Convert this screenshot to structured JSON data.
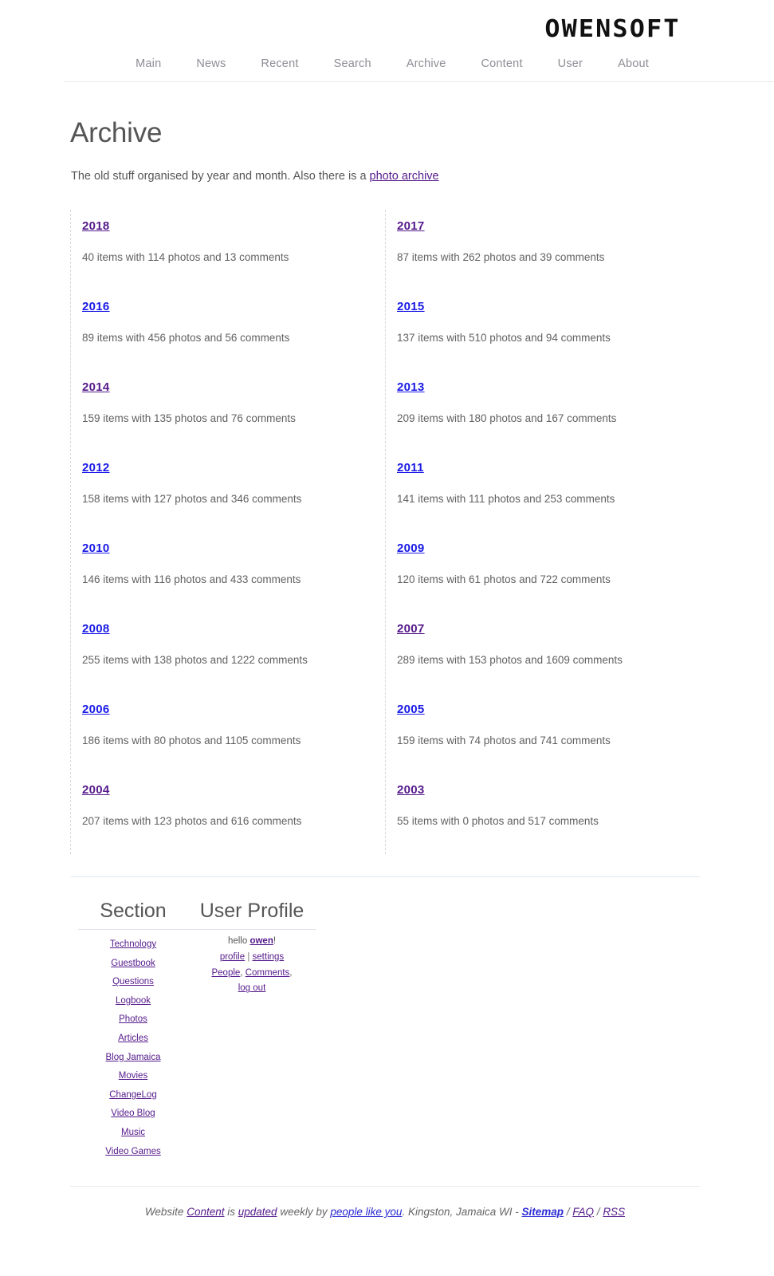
{
  "site": {
    "logo": "OWENSOFT"
  },
  "nav": {
    "items": [
      {
        "label": "Main"
      },
      {
        "label": "News"
      },
      {
        "label": "Recent"
      },
      {
        "label": "Search"
      },
      {
        "label": "Archive"
      },
      {
        "label": "Content"
      },
      {
        "label": "User"
      },
      {
        "label": "About"
      }
    ]
  },
  "page": {
    "title": "Archive",
    "intro_before": "The old stuff organised by year and month. Also there is a ",
    "intro_link": "photo archive"
  },
  "archive": {
    "left": [
      {
        "year": "2018",
        "state": "visited",
        "stats": "40 items with 114 photos and 13 comments"
      },
      {
        "year": "2016",
        "state": "unvisited",
        "stats": "89 items with 456 photos and 56 comments"
      },
      {
        "year": "2014",
        "state": "visited",
        "stats": "159 items with 135 photos and 76 comments"
      },
      {
        "year": "2012",
        "state": "unvisited",
        "stats": "158 items with 127 photos and 346 comments"
      },
      {
        "year": "2010",
        "state": "unvisited",
        "stats": "146 items with 116 photos and 433 comments"
      },
      {
        "year": "2008",
        "state": "unvisited",
        "stats": "255 items with 138 photos and 1222 comments"
      },
      {
        "year": "2006",
        "state": "unvisited",
        "stats": "186 items with 80 photos and 1105 comments"
      },
      {
        "year": "2004",
        "state": "visited",
        "stats": "207 items with 123 photos and 616 comments"
      }
    ],
    "right": [
      {
        "year": "2017",
        "state": "visited",
        "stats": "87 items with 262 photos and 39 comments"
      },
      {
        "year": "2015",
        "state": "unvisited",
        "stats": "137 items with 510 photos and 94 comments"
      },
      {
        "year": "2013",
        "state": "unvisited",
        "stats": "209 items with 180 photos and 167 comments"
      },
      {
        "year": "2011",
        "state": "unvisited",
        "stats": "141 items with 111 photos and 253 comments"
      },
      {
        "year": "2009",
        "state": "unvisited",
        "stats": "120 items with 61 photos and 722 comments"
      },
      {
        "year": "2007",
        "state": "visited",
        "stats": "289 items with 153 photos and 1609 comments"
      },
      {
        "year": "2005",
        "state": "unvisited",
        "stats": "159 items with 74 photos and 741 comments"
      },
      {
        "year": "2003",
        "state": "visited",
        "stats": "55 items with 0 photos and 517 comments"
      }
    ]
  },
  "section_panel": {
    "heading": "Section",
    "items": [
      {
        "label": "Technology"
      },
      {
        "label": "Guestbook"
      },
      {
        "label": "Questions"
      },
      {
        "label": "Logbook"
      },
      {
        "label": "Photos"
      },
      {
        "label": "Articles"
      },
      {
        "label": "Blog Jamaica"
      },
      {
        "label": "Movies"
      },
      {
        "label": "ChangeLog"
      },
      {
        "label": "Video Blog"
      },
      {
        "label": "Music"
      },
      {
        "label": "Video Games"
      }
    ]
  },
  "user_panel": {
    "heading": "User Profile",
    "greeting_prefix": "hello ",
    "username": "owen",
    "greeting_suffix": "!",
    "profile_label": "profile",
    "separator": " | ",
    "settings_label": "settings",
    "people_label": "People",
    "people_sep": ", ",
    "comments_label": "Comments",
    "comments_sep": ",",
    "logout_label": "log out"
  },
  "colophon": {
    "t1": "Website ",
    "l1": "Content",
    "t2": " is ",
    "l2": "updated",
    "t3": " weekly by ",
    "l3": "people like you",
    "t4": ". Kingston, Jamaica WI - ",
    "l4": "Sitemap",
    "t5": " / ",
    "l5": "FAQ",
    "t6": " / ",
    "l6": "RSS"
  },
  "colors": {
    "link_unvisited": "#1a1ae6",
    "link_visited": "#551a8b",
    "text": "#555555",
    "nav_text": "#8d8d95"
  }
}
